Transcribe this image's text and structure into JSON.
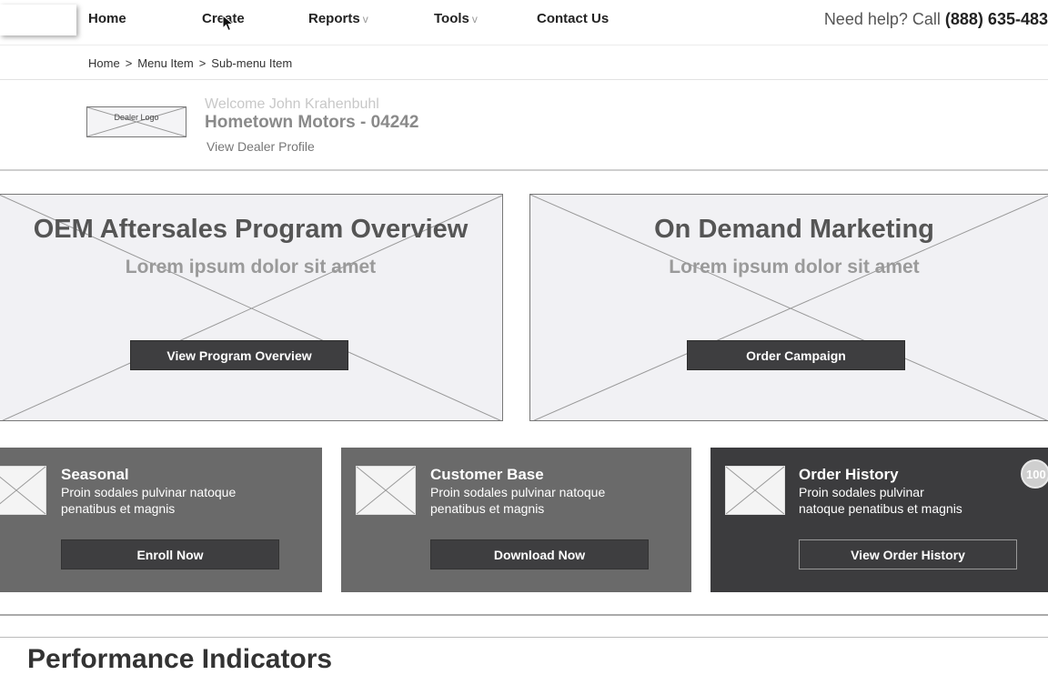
{
  "nav": {
    "items": [
      {
        "label": "Home",
        "caret": ""
      },
      {
        "label": "Create",
        "caret": ""
      },
      {
        "label": "Reports",
        "caret": "v"
      },
      {
        "label": "Tools",
        "caret": "v"
      },
      {
        "label": "Contact Us",
        "caret": ""
      }
    ],
    "help_text": "Need help? Call ",
    "help_phone": "(888) 635-483"
  },
  "breadcrumb": [
    "Home",
    "Menu Item",
    "Sub-menu Item"
  ],
  "breadcrumb_sep": ">",
  "dealer": {
    "logo_text": "Dealer Logo",
    "welcome": "Welcome John Krahenbuhl",
    "name": "Hometown Motors - 04242",
    "profile_link": "View Dealer Profile"
  },
  "heroes": [
    {
      "title": "OEM Aftersales Program Overview",
      "subtitle": "Lorem ipsum dolor sit amet",
      "button": "View Program Overview"
    },
    {
      "title": "On Demand Marketing",
      "subtitle": "Lorem ipsum dolor sit amet",
      "button": "Order Campaign"
    }
  ],
  "cards": [
    {
      "title": "Seasonal",
      "line1": "Proin sodales pulvinar natoque",
      "line2": "penatibus et magnis",
      "button": "Enroll Now"
    },
    {
      "title": "Customer Base",
      "line1": "Proin sodales pulvinar natoque",
      "line2": "penatibus et magnis",
      "button": "Download Now"
    },
    {
      "title": "Order History",
      "line1": "Proin sodales pulvinar",
      "line2": "natoque penatibus et magnis",
      "button": "View Order History",
      "badge": "100"
    }
  ],
  "bottom_title": "Performance Indicators",
  "colors": {
    "panel_bg": "#f1f1f4",
    "card_mid": "#6a6a6a",
    "card_dark": "#3c3c3e",
    "button": "#3e3e40"
  }
}
